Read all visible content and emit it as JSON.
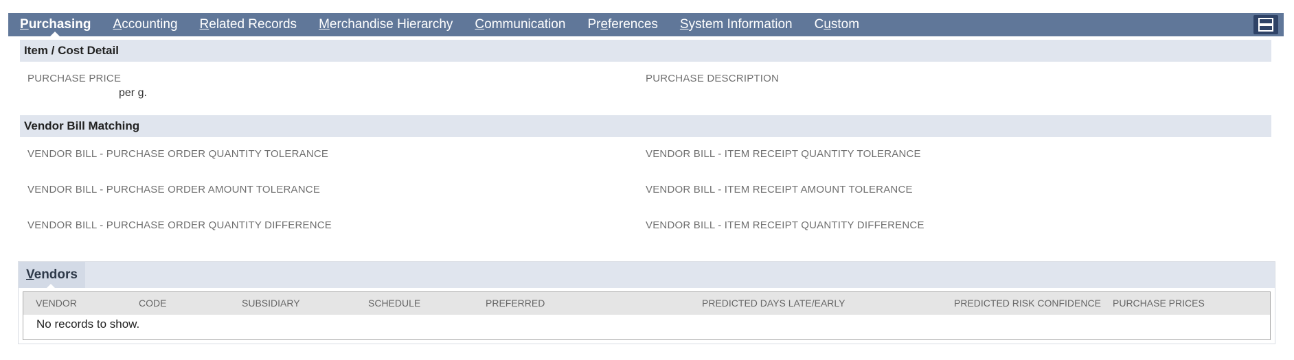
{
  "tabs": [
    {
      "pre": "",
      "ul": "P",
      "post": "urchasing"
    },
    {
      "pre": "",
      "ul": "A",
      "post": "ccounting"
    },
    {
      "pre": "",
      "ul": "R",
      "post": "elated Records"
    },
    {
      "pre": "",
      "ul": "M",
      "post": "erchandise Hierarchy"
    },
    {
      "pre": "",
      "ul": "C",
      "post": "ommunication"
    },
    {
      "pre": "Pr",
      "ul": "e",
      "post": "ferences"
    },
    {
      "pre": "",
      "ul": "S",
      "post": "ystem Information"
    },
    {
      "pre": "C",
      "ul": "u",
      "post": "stom"
    }
  ],
  "item_cost": {
    "header": "Item / Cost Detail",
    "purchase_price_label": "PURCHASE PRICE",
    "purchase_price_unit": "per g.",
    "purchase_description_label": "PURCHASE DESCRIPTION"
  },
  "vendor_bill": {
    "header": "Vendor Bill Matching",
    "po_qty_tol": "VENDOR BILL - PURCHASE ORDER QUANTITY TOLERANCE",
    "ir_qty_tol": "VENDOR BILL - ITEM RECEIPT QUANTITY TOLERANCE",
    "po_amt_tol": "VENDOR BILL - PURCHASE ORDER AMOUNT TOLERANCE",
    "ir_amt_tol": "VENDOR BILL - ITEM RECEIPT AMOUNT TOLERANCE",
    "po_qty_diff": "VENDOR BILL - PURCHASE ORDER QUANTITY DIFFERENCE",
    "ir_qty_diff": "VENDOR BILL - ITEM RECEIPT QUANTITY DIFFERENCE"
  },
  "vendors": {
    "tab_ul": "V",
    "tab_rest": "endors",
    "columns": [
      "VENDOR",
      "CODE",
      "SUBSIDIARY",
      "SCHEDULE",
      "PREFERRED",
      "PREDICTED DAYS LATE/EARLY",
      "PREDICTED RISK CONFIDENCE",
      "PURCHASE PRICES"
    ],
    "empty_text": "No records to show."
  }
}
